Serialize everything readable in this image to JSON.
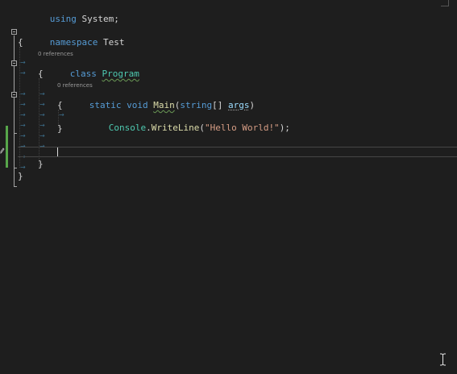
{
  "editor": {
    "lines": {
      "using": {
        "kw": "using",
        "rest": " System;"
      },
      "namespace": {
        "kw": "namespace",
        "rest": " Test"
      },
      "ns_open": "{",
      "class_lens": "0 references",
      "class_decl": {
        "kw": "class",
        "name": "Program"
      },
      "class_open": "{",
      "method_lens": "0 references",
      "method_decl": {
        "kw_static": "static",
        "kw_void": "void",
        "name": "Main",
        "open_paren": "(",
        "kw_string": "string",
        "brackets": "[] ",
        "param": "args",
        "close_paren": ")"
      },
      "method_open": "{",
      "statement": {
        "type": "Console",
        "dot": ".",
        "method": "WriteLine",
        "open_paren": "(",
        "string": "\"Hello World!\"",
        "close": ");"
      },
      "method_close": "}",
      "class_close": "}",
      "ns_close": "}"
    },
    "colors": {
      "background": "#1e1e1e",
      "keyword": "#569cd6",
      "type": "#4ec9b0",
      "method": "#dcdcaa",
      "parameter": "#9cdcfe",
      "string": "#d69d85",
      "plain": "#d4d4d4",
      "change_bar": "#57a64a"
    },
    "icons": {
      "pencil": "pencil-icon",
      "ibeam": "ibeam-cursor-icon"
    }
  }
}
